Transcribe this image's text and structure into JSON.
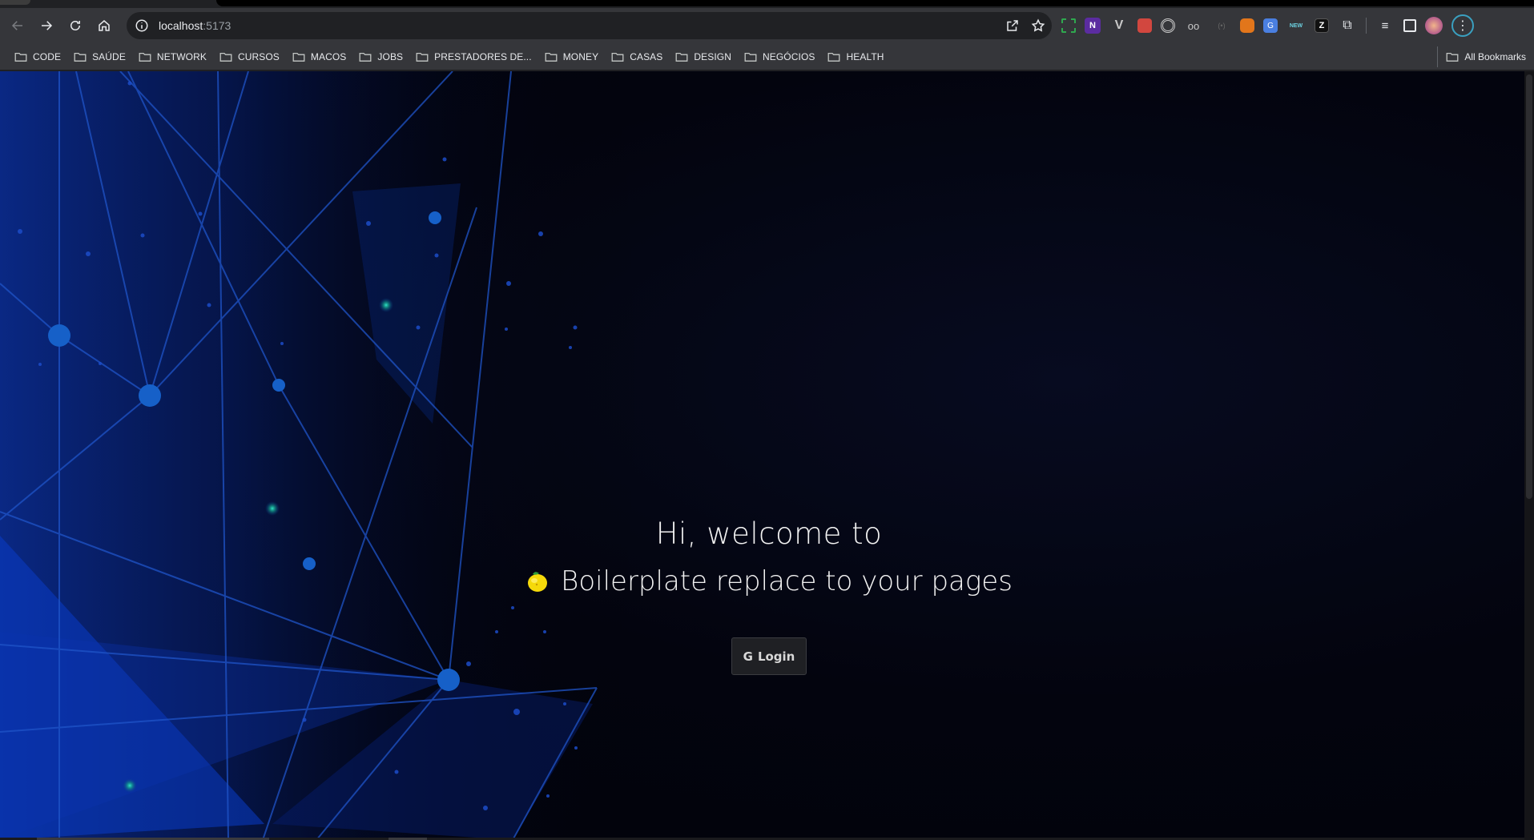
{
  "browser": {
    "url_host": "localhost",
    "url_port": ":5173",
    "bookmarks": [
      {
        "label": "CODE"
      },
      {
        "label": "SAÚDE"
      },
      {
        "label": "NETWORK"
      },
      {
        "label": "CURSOS"
      },
      {
        "label": "MACOS"
      },
      {
        "label": "JOBS"
      },
      {
        "label": "PRESTADORES DE..."
      },
      {
        "label": "MONEY"
      },
      {
        "label": "CASAS"
      },
      {
        "label": "DESIGN"
      },
      {
        "label": "NEGÓCIOS"
      },
      {
        "label": "HEALTH"
      }
    ],
    "all_bookmarks_label": "All Bookmarks",
    "extension_icons": [
      "green-bracket-icon",
      "n-letter-extension-icon",
      "vue-devtools-icon",
      "red-extension-icon",
      "target-extension-icon",
      "eyes-extension-icon",
      "dim-extension-icon",
      "metamask-fox-icon",
      "google-translate-icon",
      "new-badge-extension-icon",
      "z-extension-icon",
      "puzzle-extensions-icon"
    ]
  },
  "page": {
    "heading": "Hi, welcome to",
    "subheading": "Boilerplate replace to your pages",
    "login_label": "Login",
    "login_icon": "google-g-icon",
    "background": "network-graph-blue",
    "accent": "#0d3fa8"
  }
}
